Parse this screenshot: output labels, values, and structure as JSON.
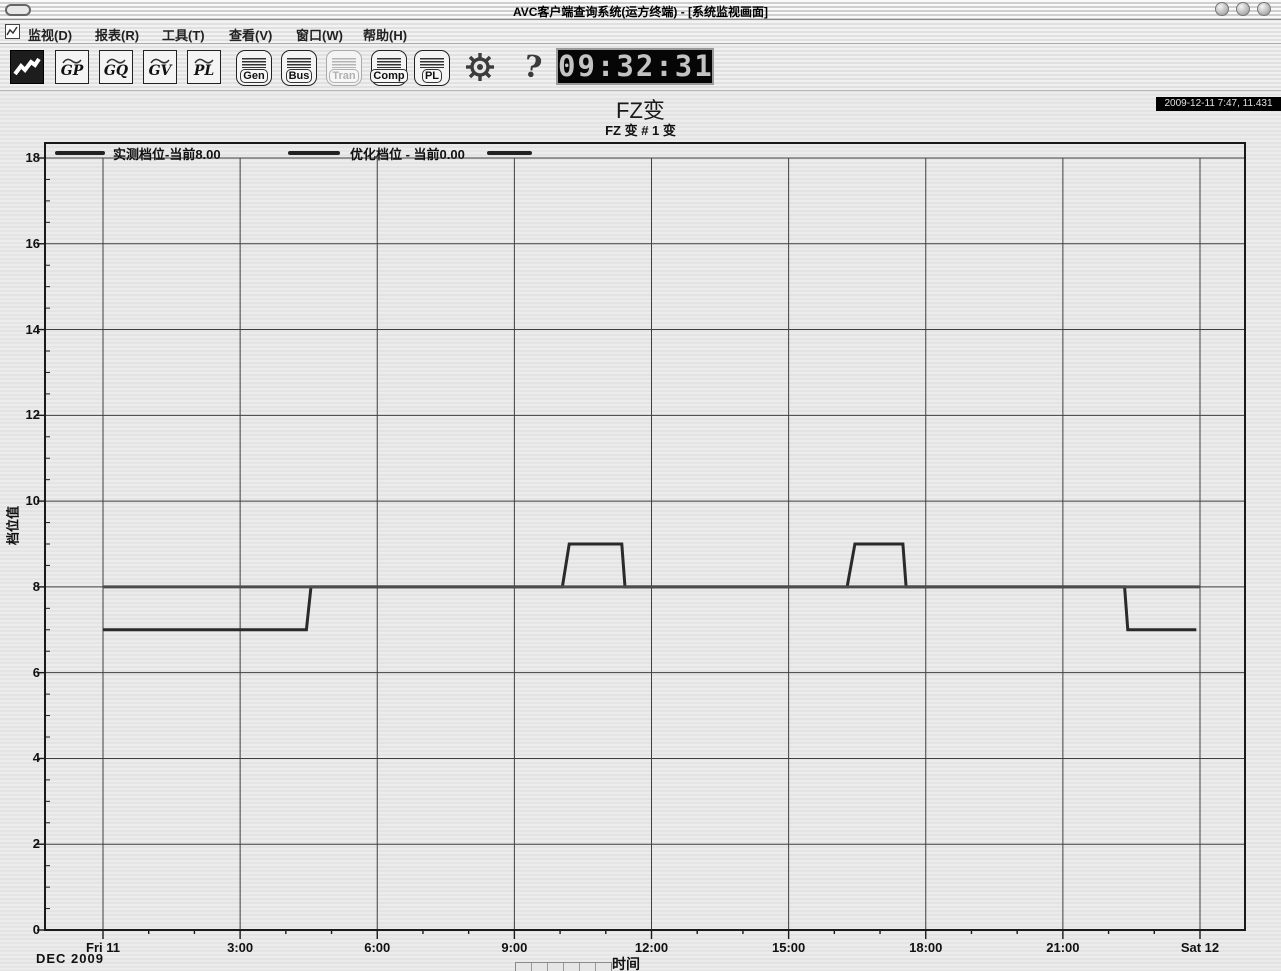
{
  "window": {
    "title": "AVC客户端查询系统(运方终端) - [系统监视画面]"
  },
  "menu": {
    "items": [
      {
        "label": "监视(D)"
      },
      {
        "label": "报表(R)"
      },
      {
        "label": "工具(T)"
      },
      {
        "label": "查看(V)"
      },
      {
        "label": "窗口(W)"
      },
      {
        "label": "帮助(H)"
      }
    ]
  },
  "toolbar": {
    "wave_buttons": [
      {
        "label": "GP"
      },
      {
        "label": "GQ"
      },
      {
        "label": "GV"
      },
      {
        "label": "PL"
      }
    ],
    "device_buttons": [
      {
        "label": "Gen"
      },
      {
        "label": "Bus"
      },
      {
        "label": "Tran"
      },
      {
        "label": "Comp"
      },
      {
        "label": "PL"
      }
    ],
    "clock": "09:32:31"
  },
  "status": {
    "timestamp": "2009-12-11 7:47, 11.431"
  },
  "chart_data": {
    "type": "line",
    "title": "FZ变",
    "subtitle": "FZ 变 # 1 变",
    "xlabel": "时间",
    "ylabel": "档位值",
    "month_label": "DEC 2009",
    "ylim": [
      0,
      18
    ],
    "xlim_hours": [
      0,
      24
    ],
    "grid": true,
    "legend_position": "top",
    "y_ticks": [
      0,
      2,
      4,
      6,
      8,
      10,
      12,
      14,
      16,
      18
    ],
    "x_ticks": {
      "hours": [
        0,
        3,
        6,
        9,
        12,
        15,
        18,
        21,
        24
      ],
      "labels": [
        "Fri 11",
        "3:00",
        "6:00",
        "9:00",
        "12:00",
        "15:00",
        "18:00",
        "21:00",
        "Sat 12"
      ]
    },
    "series": [
      {
        "name": "实测档位-当前8.00",
        "current_value": 8.0,
        "color": "#2a2a2a",
        "points_time_hours_vs_tap": [
          [
            0,
            7
          ],
          [
            4.45,
            7
          ],
          [
            4.55,
            8
          ],
          [
            10.05,
            8
          ],
          [
            10.2,
            9
          ],
          [
            11.35,
            9
          ],
          [
            11.42,
            8
          ],
          [
            16.28,
            8
          ],
          [
            16.45,
            9
          ],
          [
            17.5,
            9
          ],
          [
            17.57,
            8
          ],
          [
            22.35,
            8
          ],
          [
            22.42,
            7
          ],
          [
            23.92,
            7
          ]
        ]
      },
      {
        "name": "优化档位 - 当前0.00",
        "current_value": 0.0,
        "color": "#4d4d4d",
        "points_time_hours_vs_tap": [
          [
            0,
            8
          ],
          [
            24,
            8
          ]
        ]
      }
    ],
    "legend": [
      {
        "label": "实测档位-当前8.00"
      },
      {
        "label": "优化档位 - 当前0.00"
      },
      {
        "label": ""
      }
    ]
  }
}
